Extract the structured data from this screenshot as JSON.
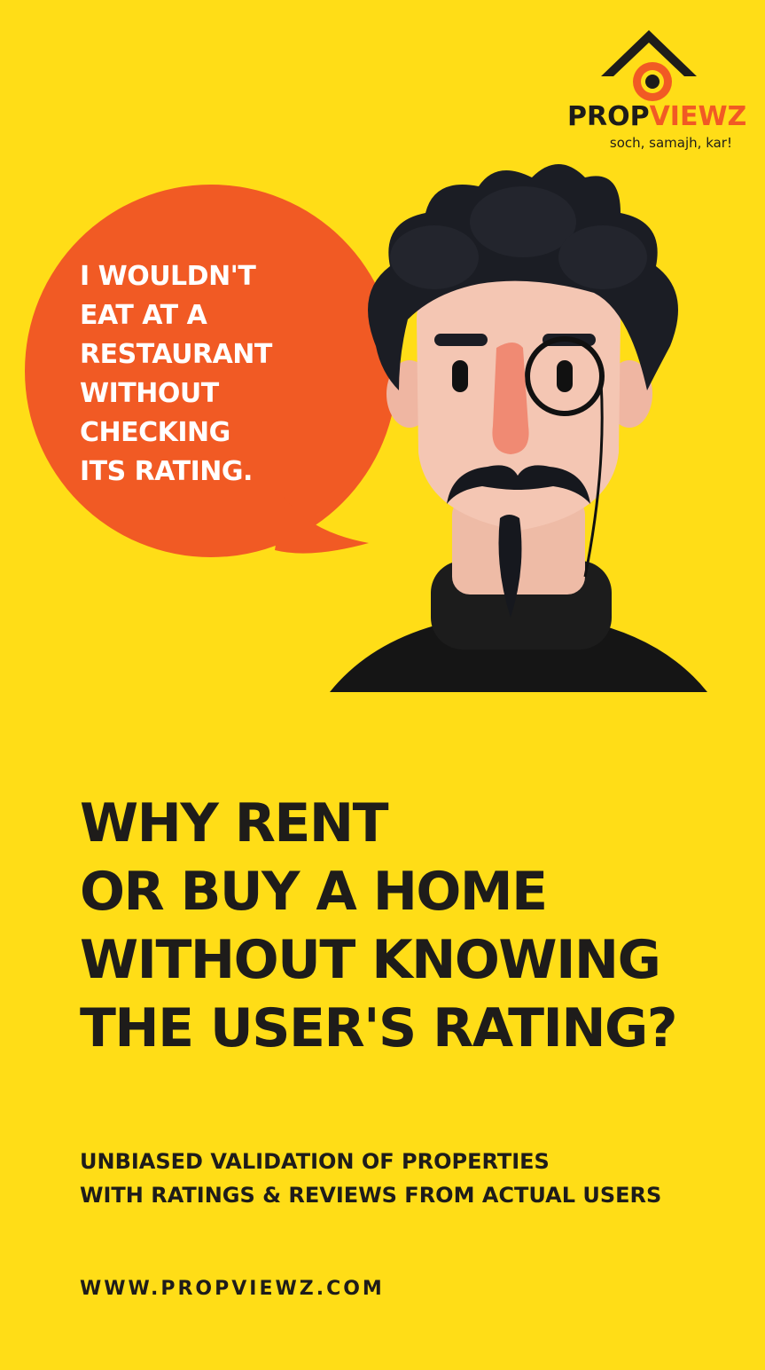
{
  "brand": {
    "name_part1": "PROP",
    "name_part2": "VIEWZ",
    "tagline": "soch, samajh, kar!"
  },
  "bubble": {
    "text": "I WOULDN'T\nEAT AT A\nRESTAURANT\nWITHOUT\nCHECKING\nITS RATING."
  },
  "headline": {
    "text": "WHY RENT\nOR BUY A HOME\nWITHOUT KNOWING\nTHE USER'S RATING?"
  },
  "subline": {
    "text": "UNBIASED VALIDATION OF PROPERTIES\nWITH RATINGS & REVIEWS FROM ACTUAL USERS"
  },
  "website": {
    "url": "WWW.PROPVIEWZ.COM"
  },
  "colors": {
    "background": "#FFDD17",
    "accent": "#F15A24",
    "text": "#1E1C1A",
    "skin": "#F2C4B0",
    "nose": "#F08A73",
    "hair": "#1B1D24"
  },
  "icons": {
    "logo": "house-eye-logo-icon",
    "illustration": "mustached-man-with-monocle"
  }
}
